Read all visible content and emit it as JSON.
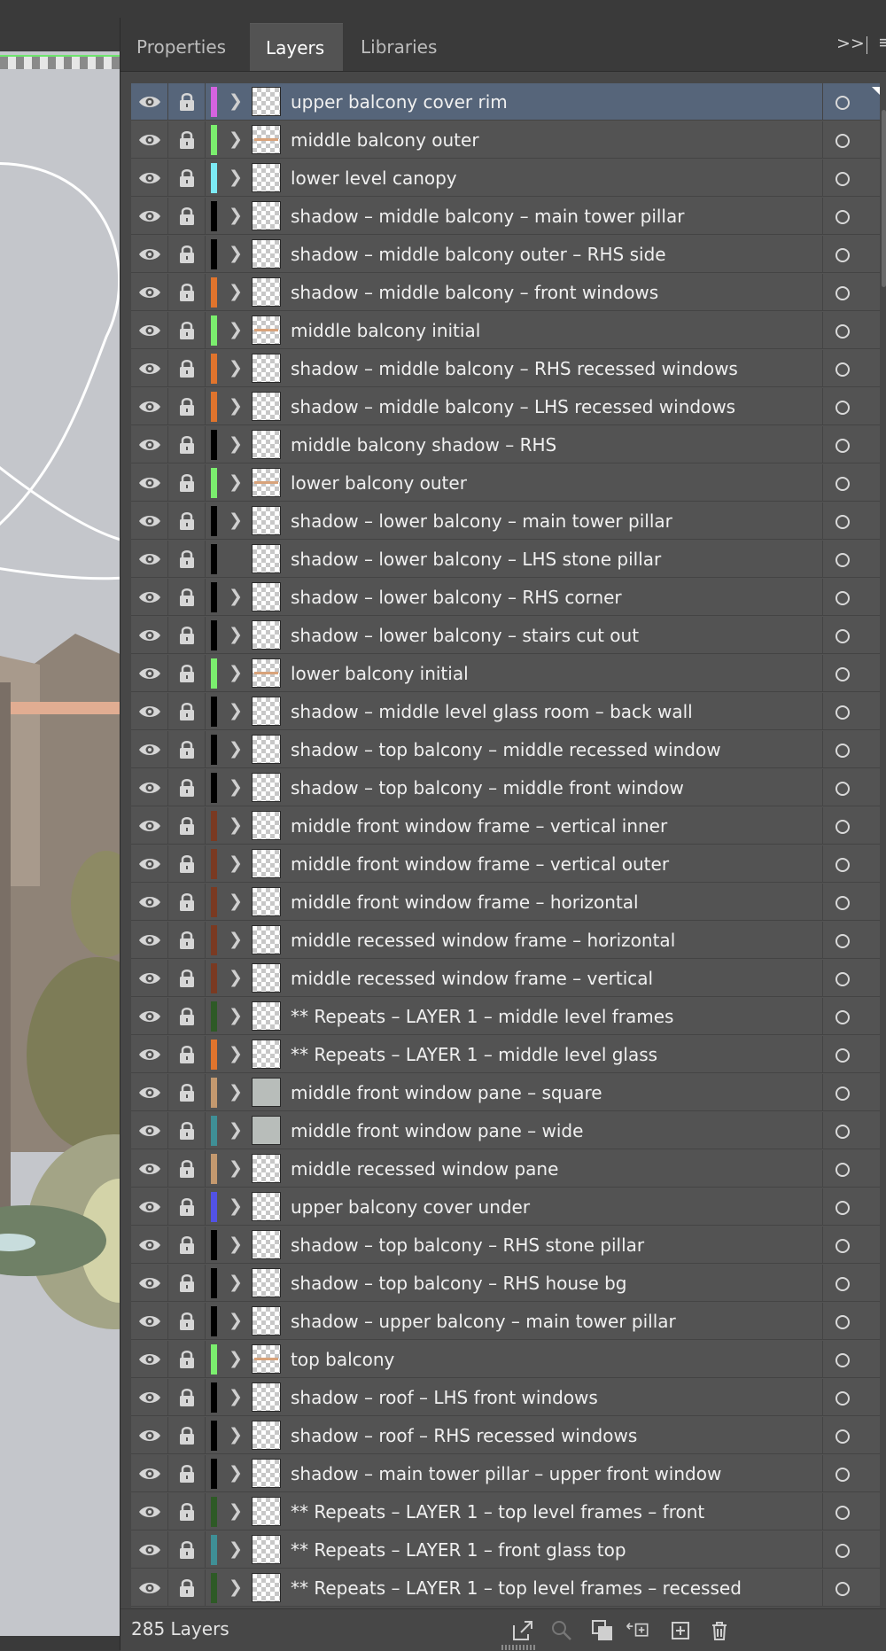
{
  "tabs": [
    {
      "label": "Properties",
      "active": false
    },
    {
      "label": "Layers",
      "active": true
    },
    {
      "label": "Libraries",
      "active": false
    }
  ],
  "panel_controls": {
    "expand": ">>",
    "menu": "≡"
  },
  "layers": [
    {
      "name": "upper balcony cover rim",
      "color": "#d563e0",
      "expandable": true,
      "thumb": "checker",
      "selected": true
    },
    {
      "name": "middle balcony outer",
      "color": "#7bee6e",
      "expandable": true,
      "thumb": "striped"
    },
    {
      "name": "lower level canopy",
      "color": "#7ceaf5",
      "expandable": true,
      "thumb": "checker"
    },
    {
      "name": "shadow – middle balcony – main tower pillar",
      "color": "#000000",
      "expandable": true,
      "thumb": "checker"
    },
    {
      "name": "shadow – middle balcony outer – RHS side",
      "color": "#000000",
      "expandable": true,
      "thumb": "checker"
    },
    {
      "name": "shadow – middle balcony – front windows",
      "color": "#e0742d",
      "expandable": true,
      "thumb": "checker"
    },
    {
      "name": "middle balcony initial",
      "color": "#7bee6e",
      "expandable": true,
      "thumb": "striped"
    },
    {
      "name": "shadow – middle balcony – RHS recessed windows",
      "color": "#e0742d",
      "expandable": true,
      "thumb": "checker"
    },
    {
      "name": "shadow – middle balcony – LHS recessed windows",
      "color": "#e0742d",
      "expandable": true,
      "thumb": "checker"
    },
    {
      "name": "middle balcony shadow – RHS",
      "color": "#000000",
      "expandable": true,
      "thumb": "checker"
    },
    {
      "name": "lower balcony outer",
      "color": "#7bee6e",
      "expandable": true,
      "thumb": "striped"
    },
    {
      "name": "shadow – lower balcony – main tower pillar",
      "color": "#000000",
      "expandable": true,
      "thumb": "checker"
    },
    {
      "name": "shadow – lower balcony – LHS stone pillar",
      "color": "#000000",
      "expandable": false,
      "thumb": "checker"
    },
    {
      "name": "shadow – lower balcony – RHS corner",
      "color": "#000000",
      "expandable": true,
      "thumb": "checker"
    },
    {
      "name": "shadow – lower balcony – stairs cut out",
      "color": "#000000",
      "expandable": true,
      "thumb": "checker"
    },
    {
      "name": "lower balcony initial",
      "color": "#7bee6e",
      "expandable": true,
      "thumb": "striped"
    },
    {
      "name": "shadow – middle level glass room – back wall",
      "color": "#000000",
      "expandable": true,
      "thumb": "checker"
    },
    {
      "name": "shadow – top balcony – middle recessed window",
      "color": "#000000",
      "expandable": true,
      "thumb": "checker"
    },
    {
      "name": "shadow – top balcony – middle front window",
      "color": "#000000",
      "expandable": true,
      "thumb": "checker"
    },
    {
      "name": "middle front window frame – vertical inner",
      "color": "#7a3a22",
      "expandable": true,
      "thumb": "checker"
    },
    {
      "name": "middle front window frame – vertical outer",
      "color": "#7a3a22",
      "expandable": true,
      "thumb": "checker"
    },
    {
      "name": "middle front window frame – horizontal",
      "color": "#7a3a22",
      "expandable": true,
      "thumb": "checker"
    },
    {
      "name": "middle recessed window frame – horizontal",
      "color": "#7a3a22",
      "expandable": true,
      "thumb": "checker"
    },
    {
      "name": "middle recessed window frame – vertical",
      "color": "#7a3a22",
      "expandable": true,
      "thumb": "checker"
    },
    {
      "name": " ** Repeats – LAYER 1 – middle level frames",
      "color": "#2e5a26",
      "expandable": true,
      "thumb": "checker"
    },
    {
      "name": " ** Repeats – LAYER 1 – middle level glass",
      "color": "#e0742d",
      "expandable": true,
      "thumb": "checker"
    },
    {
      "name": "middle front window pane – square",
      "color": "#c4996f",
      "expandable": true,
      "thumb": "solid"
    },
    {
      "name": "middle front window pane – wide",
      "color": "#3f8f96",
      "expandable": true,
      "thumb": "solid"
    },
    {
      "name": "middle recessed window pane",
      "color": "#c4996f",
      "expandable": true,
      "thumb": "checker"
    },
    {
      "name": "upper balcony cover under",
      "color": "#5252e6",
      "expandable": true,
      "thumb": "checker"
    },
    {
      "name": "shadow – top balcony – RHS stone pillar",
      "color": "#000000",
      "expandable": true,
      "thumb": "checker"
    },
    {
      "name": "shadow – top balcony – RHS house bg",
      "color": "#000000",
      "expandable": true,
      "thumb": "checker"
    },
    {
      "name": "shadow – upper balcony – main tower pillar",
      "color": "#000000",
      "expandable": true,
      "thumb": "checker"
    },
    {
      "name": "top balcony",
      "color": "#7bee6e",
      "expandable": true,
      "thumb": "striped"
    },
    {
      "name": "shadow – roof – LHS front windows",
      "color": "#000000",
      "expandable": true,
      "thumb": "checker"
    },
    {
      "name": "shadow – roof – RHS recessed windows",
      "color": "#000000",
      "expandable": true,
      "thumb": "checker"
    },
    {
      "name": "shadow – main tower pillar – upper front window",
      "color": "#000000",
      "expandable": true,
      "thumb": "checker"
    },
    {
      "name": "** Repeats – LAYER 1 – top level frames – front",
      "color": "#2e5a26",
      "expandable": true,
      "thumb": "checker"
    },
    {
      "name": "** Repeats – LAYER 1 – front glass top",
      "color": "#3f8f96",
      "expandable": true,
      "thumb": "checker"
    },
    {
      "name": "** Repeats – LAYER 1 – top level frames – recessed",
      "color": "#2e5a26",
      "expandable": true,
      "thumb": "checker"
    }
  ],
  "footer": {
    "layer_count": "285 Layers"
  }
}
